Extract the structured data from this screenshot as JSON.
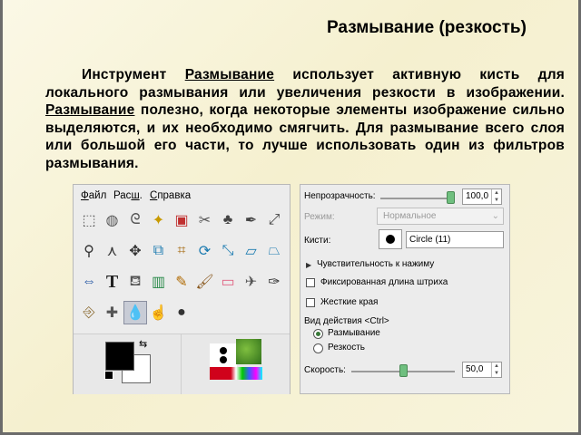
{
  "slide": {
    "title": "Размывание (резкость)",
    "paragraph_parts": [
      "Инструмент ",
      "Размывание",
      " использует активную кисть для локального размывания или увеличения резкости в изображении. ",
      "Размывание",
      " полезно, когда некоторые элементы изображение сильно выделяются, и их необходимо смягчить. Для размывание всего слоя или большой его части, то лучше использовать один из фильтров размывания."
    ]
  },
  "toolbox": {
    "menu": [
      {
        "label": "Файл",
        "mnemonic_index": 0
      },
      {
        "label": "Расш.",
        "mnemonic_index": 3
      },
      {
        "label": "Справка",
        "mnemonic_index": 0
      }
    ],
    "icons": [
      "rect-select-icon",
      "ellipse-select-icon",
      "free-select-icon",
      "fuzzy-select-icon",
      "select-by-color-icon",
      "scissors-select-icon",
      "foreground-select-icon",
      "paths-icon",
      "color-picker-icon",
      "zoom-icon",
      "measure-icon",
      "move-icon",
      "align-icon",
      "crop-icon",
      "rotate-icon",
      "scale-icon",
      "shear-icon",
      "perspective-icon",
      "flip-icon",
      "text-icon",
      "bucket-fill-icon",
      "blend-icon",
      "pencil-icon",
      "paintbrush-icon",
      "eraser-icon",
      "airbrush-icon",
      "ink-icon",
      "clone-icon",
      "heal-icon",
      "blur-sharpen-icon",
      "smudge-icon",
      "dodge-burn-icon"
    ],
    "selected_icon": "blur-sharpen-icon",
    "foreground_color": "#000000",
    "background_color": "#ffffff"
  },
  "options": {
    "opacity_label": "Непрозрачность:",
    "opacity_value": "100,0",
    "opacity_fraction": 1.0,
    "mode_label": "Режим:",
    "mode_value": "Нормальное",
    "brush_label": "Кисти:",
    "brush_value": "Circle (11)",
    "pressure_label": "Чувствительность к нажиму",
    "fixed_stroke_label": "Фиксированная длина штриха",
    "fixed_stroke_checked": false,
    "hard_edges_label": "Жесткие края",
    "hard_edges_checked": false,
    "action_label": "Вид действия  <Ctrl>",
    "action_options": [
      "Размывание",
      "Резкость"
    ],
    "action_selected": "Размывание",
    "rate_label": "Скорость:",
    "rate_value": "50,0",
    "rate_fraction": 0.5
  }
}
